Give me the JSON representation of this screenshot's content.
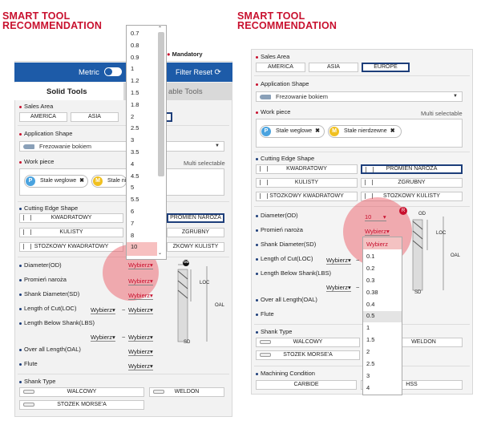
{
  "left": {
    "title_line1": "SMART TOOL",
    "title_line2": "RECOMMENDATION",
    "mandatory": "Mandatory",
    "metric": "Metric",
    "filter_reset": "Filter Reset",
    "tab_solid": "Solid Tools",
    "tab_indexable": "able Tools",
    "sales_area": "Sales Area",
    "areas": [
      "AMERICA",
      "ASIA"
    ],
    "application_shape": "Application Shape",
    "application_value": "Frezowanie bokiem",
    "work_piece": "Work piece",
    "multi": "Multi selectable",
    "chip1": {
      "letter": "P",
      "label": "Stale weglowe",
      "x": "✖"
    },
    "chip2": {
      "letter": "M",
      "label": "Stale ni"
    },
    "cutting_edge": "Cutting Edge Shape",
    "edges": [
      "KWADRATOWY",
      "KULISTY",
      "STOZKOWY KWADRATOWY"
    ],
    "edges_right": [
      "PROMIEN NAROZA",
      "ZGRUBNY",
      "ZKOWY KULISTY"
    ],
    "diameter": "Diameter(OD)",
    "corner": "Promień naroża",
    "shank": "Shank Diameter(SD)",
    "loc": "Length of Cut(LOC)",
    "lbs": "Length Below Shank(LBS)",
    "oal": "Over all Length(OAL)",
    "flute": "Flute",
    "shank_type": "Shank Type",
    "shanks": [
      "WALCOWY",
      "WELDON",
      "STOZEK MORSE'A"
    ],
    "wybierz": "Wybierz",
    "tilde": "~",
    "tool_labels": {
      "od": "OD",
      "loc": "LOC",
      "oal": "OAL",
      "sd": "SD"
    },
    "dropdown": [
      "0.7",
      "0.8",
      "0.9",
      "1",
      "1.2",
      "1.5",
      "1.8",
      "2",
      "2.5",
      "3",
      "3.5",
      "4",
      "4.5",
      "5",
      "5.5",
      "6",
      "7",
      "8",
      "10"
    ]
  },
  "right": {
    "title_line1": "SMART TOOL",
    "title_line2": "RECOMMENDATION",
    "sales_area": "Sales Area",
    "areas": [
      "AMERICA",
      "ASIA",
      "EUROPE"
    ],
    "application_shape": "Application Shape",
    "application_value": "Frezowanie bokiem",
    "work_piece": "Work piece",
    "multi": "Multi selectable",
    "chip1": {
      "letter": "P",
      "label": "Stale weglowe",
      "x": "✖"
    },
    "chip2": {
      "letter": "M",
      "label": "Stale nierdzewne",
      "x": "✖"
    },
    "cutting_edge": "Cutting Edge Shape",
    "edges_left": [
      "KWADRATOWY",
      "KULISTY",
      "STOZKOWY KWADRATOWY"
    ],
    "edges_right": [
      "PROMIEN NAROZA",
      "ZGRUBNY",
      "STOZKOWY KULISTY"
    ],
    "diameter": "Diameter(OD)",
    "diameter_value": "10",
    "corner": "Promień naroża",
    "corner_value": "Wybierz",
    "shank": "Shank Diameter(SD)",
    "loc": "Length of Cut(LOC)",
    "lbs": "Length Below Shank(LBS)",
    "oal": "Over all Length(OAL)",
    "flute": "Flute",
    "shank_type": "Shank Type",
    "shanks": [
      "WALCOWY",
      "WELDON",
      "STOZEK MORSE'A"
    ],
    "machining": "Machining Condition",
    "machining_opts": [
      "CARBIDE",
      "HSS"
    ],
    "wybierz": "Wybierz",
    "tilde": "~",
    "badge": "R",
    "tool_labels": {
      "od": "OD",
      "loc": "LOC",
      "oal": "OAL",
      "sd": "SD"
    },
    "dropdown": [
      "Wybierz",
      "0.1",
      "0.2",
      "0.3",
      "0.38",
      "0.4",
      "0.5",
      "1",
      "1.5",
      "2",
      "2.5",
      "3",
      "4"
    ]
  }
}
